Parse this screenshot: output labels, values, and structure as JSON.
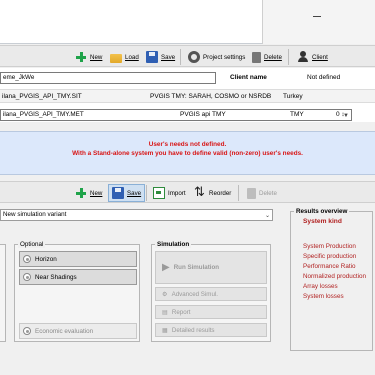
{
  "project_toolbar": {
    "new": "New",
    "load": "Load",
    "save": "Save",
    "project_settings": "Project settings",
    "delete": "Delete",
    "client": "Client"
  },
  "project": {
    "name_value": "eme_JkWe",
    "client_label": "Client name",
    "client_value": "Not defined",
    "site_file": "ilana_PVGIS_API_TMY.SIT",
    "site_source": "PVGIS TMY: SARAH, COSMO or NSRDB",
    "site_country": "Turkey",
    "meteo_file": "ilana_PVGIS_API_TMY.MET",
    "meteo_source": "PVGIS api TMY",
    "meteo_type": "TMY",
    "meteo_extra": "0 ↕"
  },
  "warning": {
    "line1": "User's needs not defined.",
    "line2": "With a Stand-alone system you have to define valid (non-zero) user's needs."
  },
  "variant_toolbar": {
    "new": "New",
    "save": "Save",
    "import": "Import",
    "reorder": "Reorder",
    "delete": "Delete"
  },
  "variant": {
    "selected": "New simulation variant"
  },
  "optional": {
    "title": "Optional",
    "horizon": "Horizon",
    "near_shadings": "Near Shadings",
    "economic_evaluation": "Economic evaluation"
  },
  "simulation": {
    "title": "Simulation",
    "run": "Run Simulation",
    "advanced": "Advanced Simul.",
    "report": "Report",
    "detailed": "Detailed results"
  },
  "results_overview": {
    "title": "Results overview",
    "system_kind": "System kind",
    "items": [
      "System Production",
      "Specific production",
      "Performance Ratio",
      "Normalized production",
      "Array losses",
      "System losses"
    ]
  },
  "colors": {
    "warning_text": "#d81515",
    "warning_bg": "#dce8fb",
    "results_text": "#b01f1f"
  }
}
